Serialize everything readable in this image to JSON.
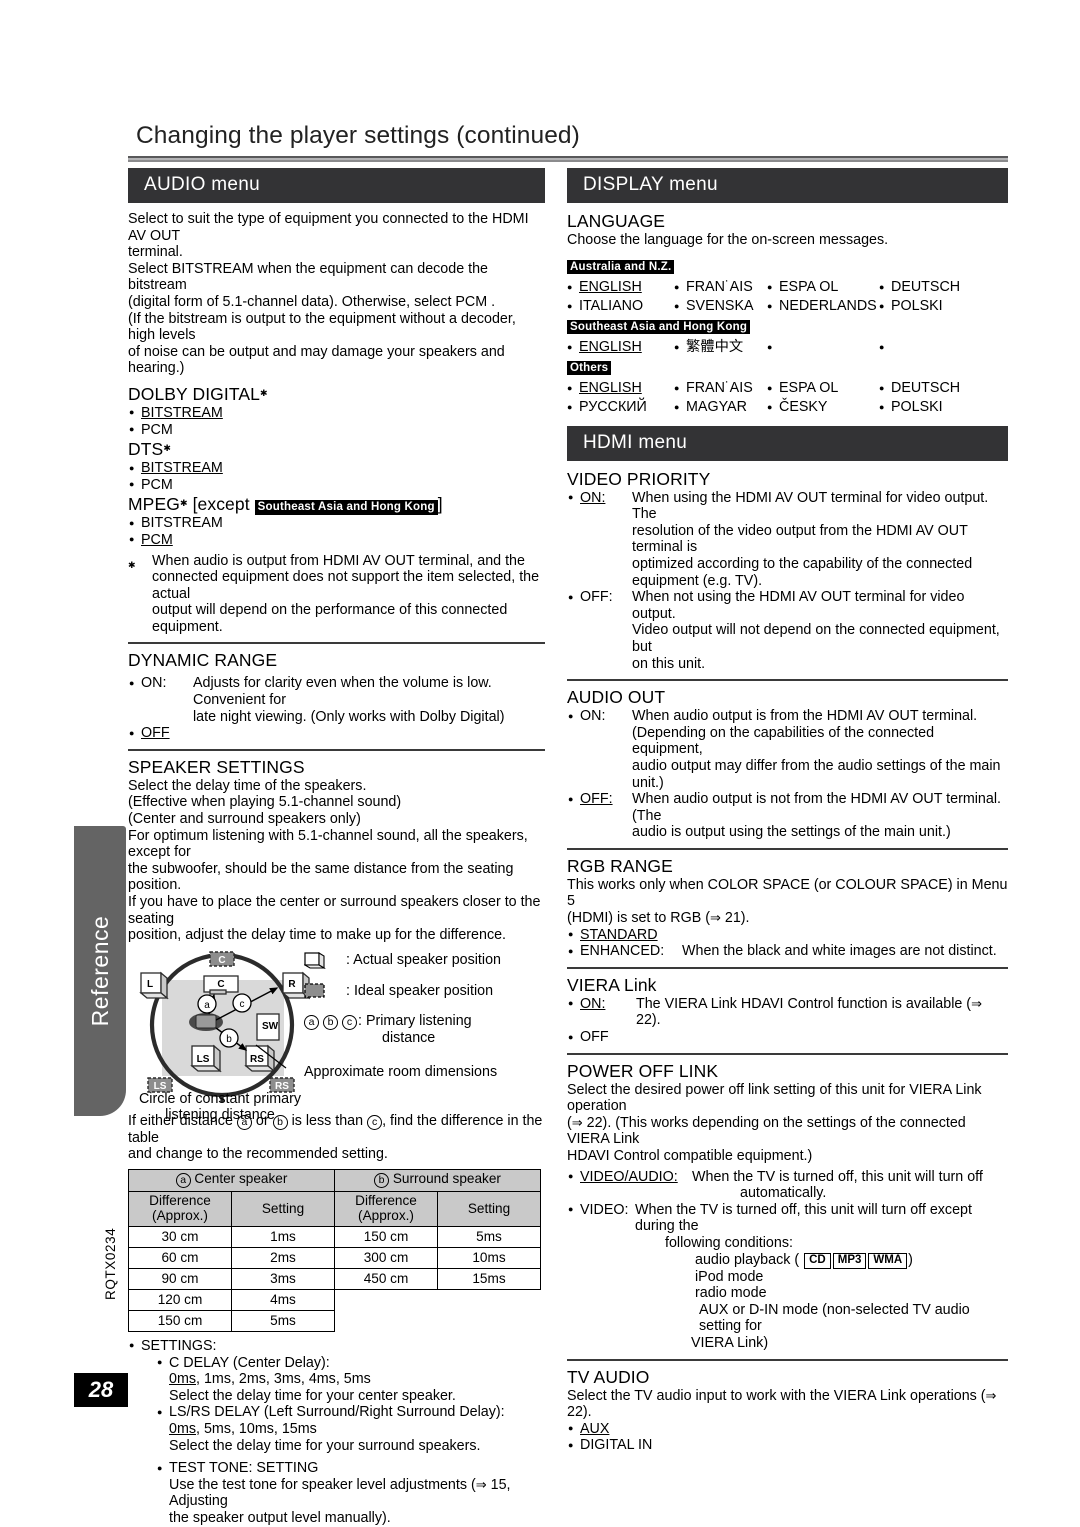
{
  "page": {
    "title": "Changing the player settings (continued)",
    "side_tab_label": "Reference",
    "doc_id": "RQTX0234",
    "page_number": "28"
  },
  "audio_menu": {
    "bar_title": "AUDIO menu",
    "intro_lines": [
      "Select to suit the type of equipment you connected to the HDMI AV OUT",
      "terminal.",
      "Select  BITSTREAM  when the equipment can decode the bitstream",
      "(digital form of 5.1-channel data). Otherwise, select  PCM .",
      "(If the bitstream is output to the equipment without a decoder, high levels",
      "of noise can be output and may damage your speakers and hearing.)"
    ],
    "dolby_digital": {
      "title": "DOLBY DIGITAL",
      "options": [
        "BITSTREAM",
        "PCM"
      ],
      "default": "BITSTREAM"
    },
    "dts": {
      "title": "DTS",
      "options": [
        "BITSTREAM",
        "PCM"
      ],
      "default": "BITSTREAM"
    },
    "mpeg": {
      "title_prefix": "MPEG",
      "title_bracket_open": "[except ",
      "title_tag": "Southeast Asia and Hong Kong",
      "title_bracket_close": "]",
      "options": [
        "BITSTREAM",
        "PCM"
      ],
      "default": "PCM"
    },
    "footnote": [
      "When audio is output from HDMI AV OUT terminal, and the",
      "connected equipment does not support the item selected, the actual",
      "output will depend on the performance of this connected equipment."
    ],
    "dynamic_range": {
      "title": "DYNAMIC RANGE",
      "on_label": "ON:",
      "on_desc_lines": [
        "Adjusts for clarity even when the volume is low. Convenient for",
        "late night viewing. (Only works with Dolby Digital)"
      ],
      "off_label": "OFF",
      "default": "OFF"
    },
    "speaker_settings": {
      "title": "SPEAKER SETTINGS",
      "intro_lines": [
        "Select the delay time of the speakers.",
        "(Effective when playing 5.1-channel sound)",
        "(Center and surround speakers only)",
        "For optimum listening with 5.1-channel sound, all the speakers, except for",
        "the subwoofer, should be the same distance from the seating position.",
        "If you have to place the center or surround speakers closer to the seating",
        "position, adjust the delay time to make up for the difference."
      ],
      "diagram": {
        "speaker_labels": [
          "L",
          "C",
          "R",
          "LS",
          "RS",
          "SW"
        ],
        "ideal_labels": [
          "C",
          "LS",
          "RS"
        ],
        "distance_marks": [
          "a",
          "b",
          "c"
        ],
        "legend": [
          ": Actual speaker position",
          ": Ideal speaker position",
          ": Primary listening"
        ],
        "legend_third_second_line": "distance",
        "legend_third_marks": [
          "a",
          "b",
          "c"
        ],
        "approx_room_label": "Approximate room dimensions",
        "circle_caption": "Circle of constant primary listening distance"
      },
      "after_diagram_lines": [
        "is less than",
        ", find the difference in the table",
        "and change to the recommended setting."
      ],
      "after_diagram_prefix": "If either distance",
      "after_diagram_or": "or",
      "table": {
        "group_headers": [
          "Center speaker",
          "Surround speaker"
        ],
        "group_marks": [
          "a",
          "b"
        ],
        "sub_headers": [
          "Difference (Approx.)",
          "Setting",
          "Difference (Approx.)",
          "Setting"
        ],
        "rows": [
          [
            "30 cm",
            "1ms",
            "150 cm",
            "5ms"
          ],
          [
            "60 cm",
            "2ms",
            "300 cm",
            "10ms"
          ],
          [
            "90 cm",
            "3ms",
            "450 cm",
            "15ms"
          ],
          [
            "120 cm",
            "4ms",
            "",
            ""
          ],
          [
            "150 cm",
            "5ms",
            "",
            ""
          ]
        ]
      },
      "settings_label": "SETTINGS:",
      "c_delay": {
        "title": "C DELAY (Center Delay):",
        "default": "0ms",
        "values_rest": ", 1ms, 2ms, 3ms, 4ms, 5ms",
        "desc": "Select the delay time for your center speaker."
      },
      "lsrs_delay": {
        "title": "LS/RS DELAY (Left Surround/Right Surround Delay):",
        "default": "0ms",
        "values_rest": ", 5ms, 10ms, 15ms",
        "desc": "Select the delay time for your surround speakers."
      },
      "test_tone": {
        "title": "TEST TONE: SETTING",
        "desc_line1": "Use the test tone for speaker level adjustments (",
        "desc_ref": "15, Adjusting",
        "desc_line2": "the speaker output level manually)."
      }
    }
  },
  "display_menu": {
    "bar_title": "DISPLAY menu",
    "language": {
      "title": "LANGUAGE",
      "intro": "Choose the language for the on-screen messages.",
      "groups": [
        {
          "tag": "Australia and N.Z.",
          "items": [
            "ENGLISH",
            "FRAN˙AIS",
            "ESPA OL",
            "DEUTSCH",
            "ITALIANO",
            "SVENSKA",
            "NEDERLANDS",
            "POLSKI"
          ],
          "default": "ENGLISH"
        },
        {
          "tag": "Southeast Asia and Hong Kong",
          "items": [
            "ENGLISH",
            "繁體中文"
          ],
          "default": "ENGLISH"
        },
        {
          "tag": "Others",
          "items": [
            "ENGLISH",
            "FRAN˙AIS",
            "ESPA OL",
            "DEUTSCH",
            "РУССКИЙ",
            "MAGYAR",
            "ČESKY",
            "POLSKI"
          ],
          "default": "ENGLISH"
        }
      ]
    }
  },
  "hdmi_menu": {
    "bar_title": "HDMI menu",
    "video_priority": {
      "title": "VIDEO PRIORITY",
      "on_label": "ON:",
      "on_default": true,
      "on_desc_lines": [
        "When using the HDMI AV OUT terminal for video output. The",
        "resolution of the video output from the HDMI AV OUT terminal is",
        "optimized according to the capability of the connected",
        "equipment (e.g. TV)."
      ],
      "off_label": "OFF:",
      "off_desc_lines": [
        "When not using the HDMI AV OUT terminal for video output.",
        "Video output will not depend on the connected equipment, but",
        "on this unit."
      ]
    },
    "audio_out": {
      "title": "AUDIO OUT",
      "on_label": "ON:",
      "on_desc_lines": [
        "When audio output is from the HDMI AV OUT terminal.",
        "(Depending on the capabilities of the connected equipment,",
        "audio output may differ from the audio settings of the main unit.)"
      ],
      "off_label": "OFF:",
      "off_default": true,
      "off_desc_lines": [
        "When audio output is not from the HDMI AV OUT terminal. (The",
        "audio is output using the settings of the main unit.)"
      ]
    },
    "rgb_range": {
      "title": "RGB RANGE",
      "intro_lines": [
        "This works only when  COLOR SPACE (or COLOUR SPACE)  in Menu 5",
        "(HDMI) is set to RGB ("
      ],
      "intro_ref": "21).",
      "standard_label": "STANDARD",
      "standard_default": true,
      "enhanced_label": "ENHANCED:",
      "enhanced_desc": "When the black and white images are not distinct."
    },
    "viera_link": {
      "title": "VIERA Link",
      "on_label": "ON:",
      "on_default": true,
      "on_desc": "The VIERA Link  HDAVI Control  function is available (",
      "on_desc_ref": "22).",
      "off_label": "OFF"
    },
    "power_off_link": {
      "title": "POWER OFF LINK",
      "intro_line1": "Select the desired power off link setting of this unit for VIERA Link operation",
      "intro_ref": "22). (This works depending on the settings of the connected VIERA Link",
      "intro_line3": " HDAVI Control  compatible equipment.)",
      "video_audio_label": "VIDEO/AUDIO:",
      "video_audio_default": true,
      "video_audio_desc_line1": "When the TV is turned off, this unit will turn off",
      "video_audio_desc_line2": "automatically.",
      "video_label": "VIDEO:",
      "video_desc_line1": "When the TV is turned off, this unit will turn off except during the",
      "video_desc_line2": "following conditions:",
      "conditions": {
        "audio_playback_label": "audio playback (",
        "audio_playback_media": [
          "CD",
          "MP3",
          "WMA"
        ],
        "audio_playback_close": ")",
        "ipod": "iPod mode",
        "radio": "radio mode",
        "aux_line1": " AUX  or  D-IN  mode (non-selected TV audio setting for",
        "aux_line2": "VIERA Link)"
      }
    },
    "tv_audio": {
      "title": "TV AUDIO",
      "intro": "Select the TV audio input to work with the VIERA Link operations (",
      "intro_ref": "22).",
      "options": [
        "AUX",
        "DIGITAL IN"
      ],
      "default": "AUX"
    }
  }
}
